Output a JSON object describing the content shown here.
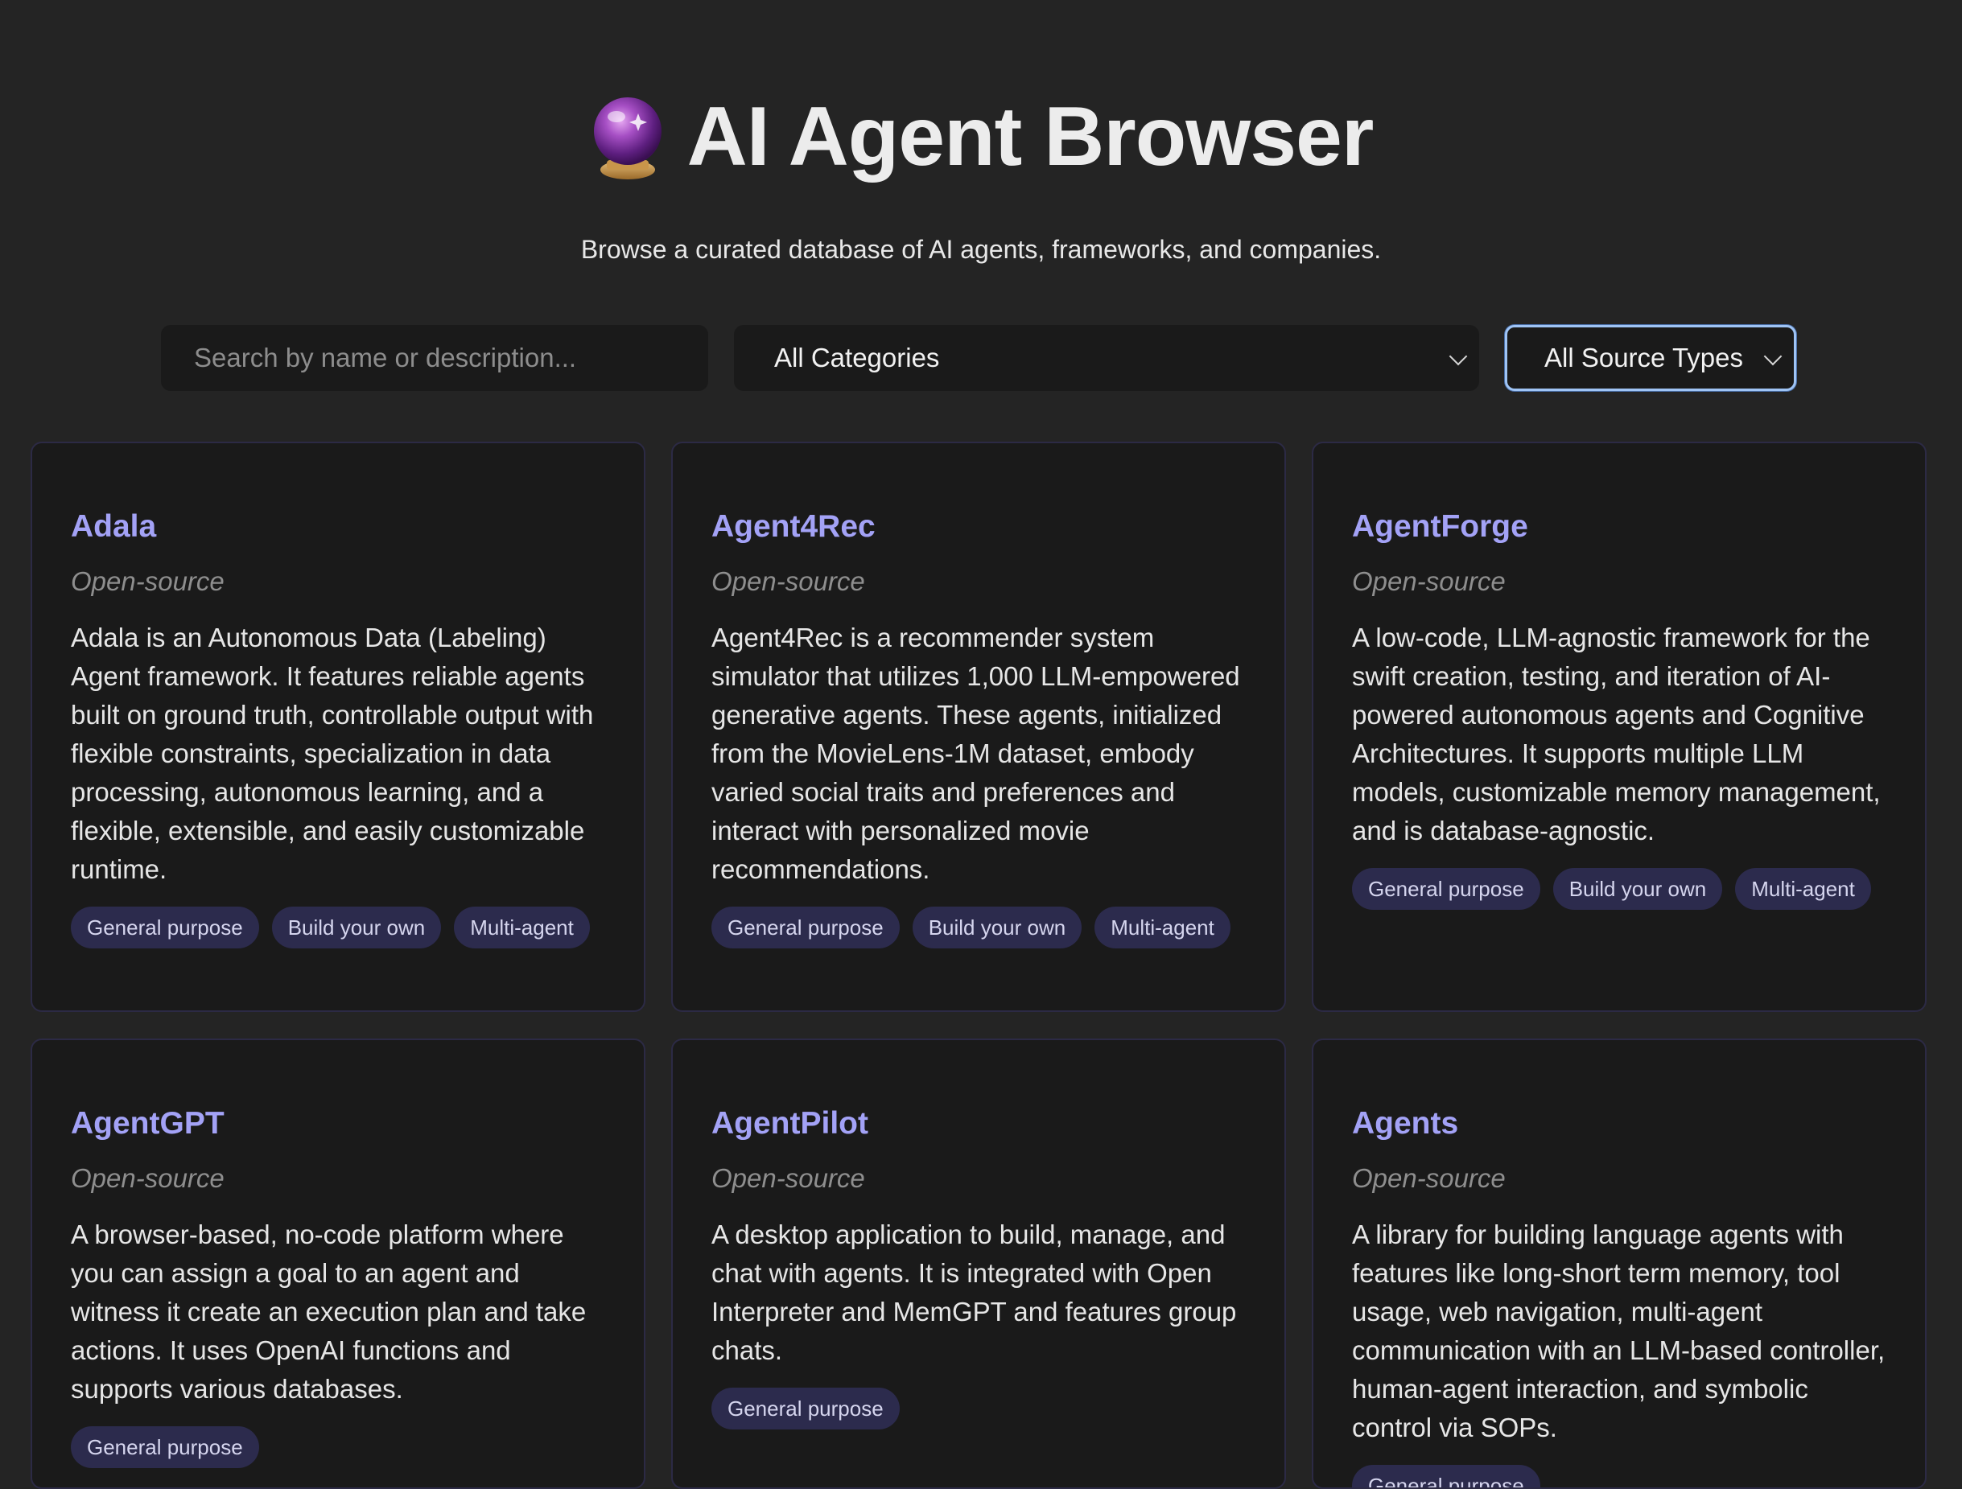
{
  "header": {
    "title": "AI Agent Browser",
    "logo_icon": "crystal-ball-icon",
    "subtitle": "Browse a curated database of AI agents, frameworks, and companies."
  },
  "filters": {
    "search_placeholder": "Search by name or description...",
    "search_value": "",
    "category_selected": "All Categories",
    "source_type_selected": "All Source Types"
  },
  "colors": {
    "background": "#242424",
    "card_background": "#1a1a1a",
    "card_title": "#a3a2f6",
    "tag_background": "#2c2b4d",
    "focus_ring": "#9fc4f5"
  },
  "cards": [
    {
      "name": "Adala",
      "source_type": "Open-source",
      "description": "Adala is an Autonomous Data (Labeling) Agent framework. It features reliable agents built on ground truth, controllable output with flexible constraints, specialization in data processing, autonomous learning, and a flexible, extensible, and easily customizable runtime.",
      "tags": [
        "General purpose",
        "Build your own",
        "Multi-agent"
      ]
    },
    {
      "name": "Agent4Rec",
      "source_type": "Open-source",
      "description": "Agent4Rec is a recommender system simulator that utilizes 1,000 LLM-empowered generative agents. These agents, initialized from the MovieLens-1M dataset, embody varied social traits and preferences and interact with personalized movie recommendations.",
      "tags": [
        "General purpose",
        "Build your own",
        "Multi-agent"
      ]
    },
    {
      "name": "AgentForge",
      "source_type": "Open-source",
      "description": "A low-code, LLM-agnostic framework for the swift creation, testing, and iteration of AI-powered autonomous agents and Cognitive Architectures. It supports multiple LLM models, customizable memory management, and is database-agnostic.",
      "tags": [
        "General purpose",
        "Build your own",
        "Multi-agent"
      ]
    },
    {
      "name": "AgentGPT",
      "source_type": "Open-source",
      "description": "A browser-based, no-code platform where you can assign a goal to an agent and witness it create an execution plan and take actions. It uses OpenAI functions and supports various databases.",
      "tags": [
        "General purpose"
      ]
    },
    {
      "name": "AgentPilot",
      "source_type": "Open-source",
      "description": "A desktop application to build, manage, and chat with agents. It is integrated with Open Interpreter and MemGPT and features group chats.",
      "tags": [
        "General purpose"
      ]
    },
    {
      "name": "Agents",
      "source_type": "Open-source",
      "description": "A library for building language agents with features like long-short term memory, tool usage, web navigation, multi-agent communication with an LLM-based controller, human-agent interaction, and symbolic control via SOPs.",
      "tags": [
        "General purpose"
      ]
    }
  ]
}
